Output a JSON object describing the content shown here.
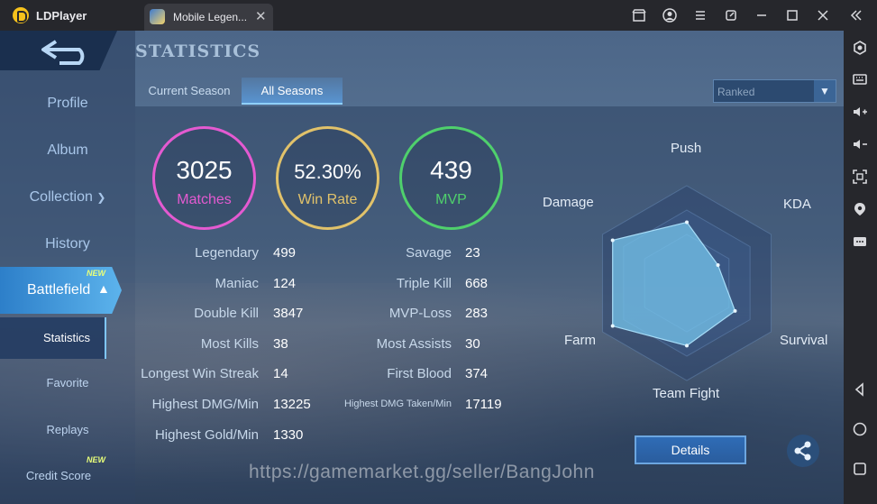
{
  "emulator": {
    "app_name": "LDPlayer",
    "tab_title": "Mobile Legen...",
    "tab_close": "✕",
    "window_controls": [
      "store-icon",
      "account-icon",
      "menu-icon",
      "restore-icon",
      "minimize-icon",
      "maximize-icon",
      "close-icon",
      "collapse-icon"
    ],
    "sidebar_tools": [
      "settings-icon",
      "keyboard-icon",
      "volume-up-icon",
      "volume-down-icon",
      "screenshot-icon",
      "location-icon",
      "more-icon",
      "back-icon",
      "home-icon",
      "recents-icon"
    ]
  },
  "game": {
    "page_title": "STATISTICS",
    "tabs": [
      "Current Season",
      "All Seasons"
    ],
    "active_tab": "All Seasons",
    "mode_select": "Ranked",
    "nav": {
      "profile": "Profile",
      "album": "Album",
      "collection": "Collection",
      "history": "History",
      "battlefield": "Battlefield",
      "statistics": "Statistics",
      "favorite": "Favorite",
      "replays": "Replays",
      "credit_score": "Credit Score",
      "new_badge": "NEW"
    },
    "circles": [
      {
        "value": "3025",
        "label": "Matches",
        "color": "#e45ad1"
      },
      {
        "value": "52.30%",
        "label": "Win Rate",
        "color": "#e1c26a"
      },
      {
        "value": "439",
        "label": "MVP",
        "color": "#4fd06c"
      }
    ],
    "stats_left": [
      {
        "label": "Legendary",
        "value": "499"
      },
      {
        "label": "Maniac",
        "value": "124"
      },
      {
        "label": "Double Kill",
        "value": "3847"
      },
      {
        "label": "Most Kills",
        "value": "38"
      },
      {
        "label": "Longest Win Streak",
        "value": "14"
      },
      {
        "label": "Highest DMG/Min",
        "value": "13225"
      },
      {
        "label": "Highest Gold/Min",
        "value": "1330"
      }
    ],
    "stats_right": [
      {
        "label": "Savage",
        "value": "23"
      },
      {
        "label": "Triple Kill",
        "value": "668"
      },
      {
        "label": "MVP-Loss",
        "value": "283"
      },
      {
        "label": "Most Assists",
        "value": "30"
      },
      {
        "label": "First Blood",
        "value": "374"
      },
      {
        "label": "Highest DMG Taken/Min",
        "value": "17119"
      }
    ],
    "radar": {
      "axes": [
        "Push",
        "KDA",
        "Survival",
        "Team Fight",
        "Farm",
        "Damage"
      ],
      "values": [
        0.71,
        0.42,
        0.65,
        0.73,
        1.0,
        1.0
      ]
    },
    "details_button": "Details",
    "watermark": "https://gamemarket.gg/seller/BangJohn"
  }
}
